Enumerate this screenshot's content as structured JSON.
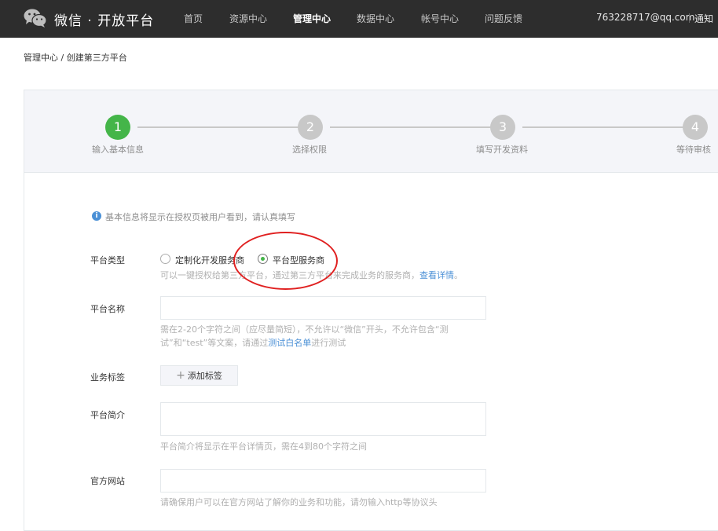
{
  "header": {
    "brand": "微信 · 开放平台",
    "nav": [
      "首页",
      "资源中心",
      "管理中心",
      "数据中心",
      "帐号中心",
      "问题反馈"
    ],
    "active_nav": "管理中心",
    "user_email": "763228717@qq.com",
    "notify": "通知"
  },
  "breadcrumb": "管理中心 / 创建第三方平台",
  "steps": [
    {
      "num": "1",
      "label": "输入基本信息",
      "state": "done"
    },
    {
      "num": "2",
      "label": "选择权限",
      "state": "pending"
    },
    {
      "num": "3",
      "label": "填写开发资料",
      "state": "pending"
    },
    {
      "num": "4",
      "label": "等待审核",
      "state": "pending"
    }
  ],
  "form": {
    "info_text": "基本信息将显示在授权页被用户看到，请认真填写",
    "platform_type": {
      "label": "平台类型",
      "option1": "定制化开发服务商",
      "option2": "平台型服务商",
      "selected": "平台型服务商",
      "hint": "可以一键授权给第三方平台，通过第三方平台来完成业务的服务商，",
      "hint_link": "查看详情",
      "hint_end": "。"
    },
    "platform_name": {
      "label": "平台名称",
      "value": "",
      "hint_line1": "需在2-20个字符之间（应尽量简短），不允许以“微信”开头，不允许包含“测",
      "hint_line2_a": "试”和“test”等文案，请通过",
      "hint_link": "测试白名单",
      "hint_line2_b": "进行测试"
    },
    "business_tag": {
      "label": "业务标签",
      "button": "添加标签"
    },
    "platform_intro": {
      "label": "平台简介",
      "value": "",
      "hint": "平台简介将显示在平台详情页，需在4到80个字符之间"
    },
    "official_site": {
      "label": "官方网站",
      "value": "",
      "hint": "请确保用户可以在官方网站了解你的业务和功能，请勿输入http等协议头"
    }
  },
  "colors": {
    "topbar": "#2d2d2d",
    "step_done": "#44b549",
    "step_pending": "#c8c8c8",
    "link": "#4b90d6",
    "annotation": "#e02020"
  }
}
